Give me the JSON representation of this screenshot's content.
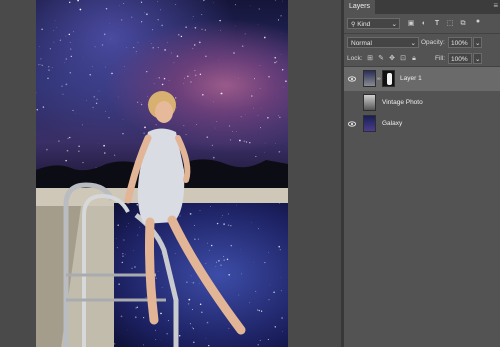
{
  "panel": {
    "tab_label": "Layers",
    "filter_kind": "Kind",
    "blend_mode": "Normal",
    "opacity_label": "Opacity:",
    "opacity_value": "100%",
    "lock_label": "Lock:",
    "fill_label": "Fill:",
    "fill_value": "100%"
  },
  "layers": [
    {
      "name": "Layer 1",
      "selected": true
    },
    {
      "name": "Vintage Photo",
      "selected": false
    },
    {
      "name": "Galaxy",
      "selected": false
    }
  ],
  "colors": {
    "panel_bg": "#535353",
    "selected_row": "#6a6a6a",
    "canvas_bg": "#4a4a4a"
  },
  "icons": [
    "search-icon",
    "chevron-down-icon",
    "image-filter-icon",
    "adjustment-filter-icon",
    "type-filter-icon",
    "shape-filter-icon",
    "smart-object-filter-icon",
    "lock-pixels-icon",
    "lock-image-icon",
    "lock-position-icon",
    "lock-artboard-icon",
    "lock-all-icon",
    "eye-icon",
    "panel-menu-icon"
  ]
}
